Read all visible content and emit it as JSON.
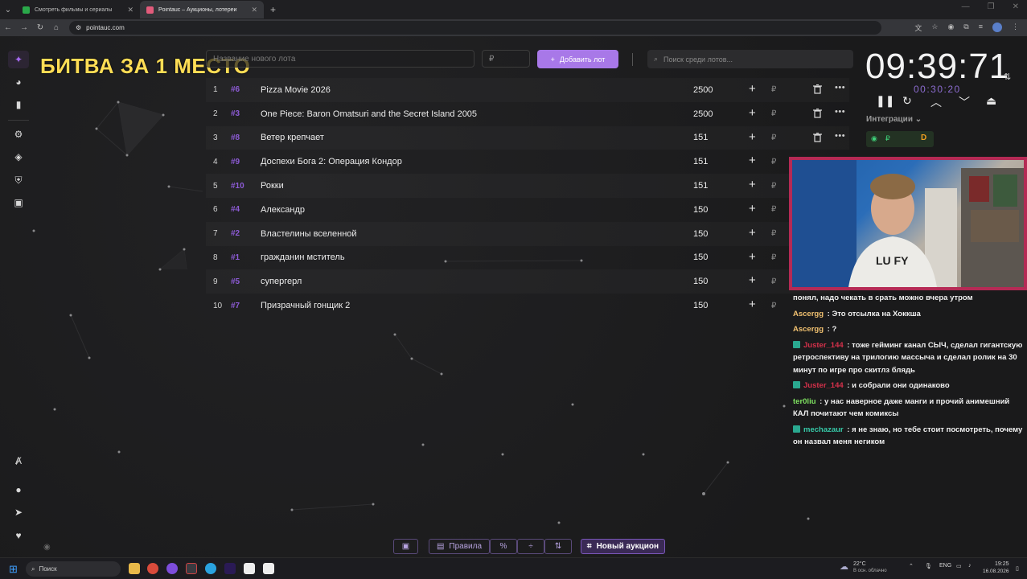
{
  "browser": {
    "tabs": [
      {
        "title": "Смотреть фильмы и сериалы",
        "active": false,
        "favicon_color": "#2aa84a"
      },
      {
        "title": "Pointauc – Аукционы, лотереи",
        "active": true,
        "favicon_color": "#e25b7b"
      }
    ],
    "url": "pointauc.com"
  },
  "overlay_title": "БИТВА ЗА 1 МЕСТО",
  "toolbar": {
    "lot_name_placeholder": "Название нового лота",
    "price_placeholder": "₽",
    "add_button": "Добавить лот",
    "search_placeholder": "Поиск среди лотов..."
  },
  "lots": [
    {
      "rank": "1",
      "id": "#6",
      "name": "Pizza Movie 2026",
      "amount": "2500"
    },
    {
      "rank": "2",
      "id": "#3",
      "name": "One Piece: Baron Omatsuri and the Secret Island 2005",
      "amount": "2500"
    },
    {
      "rank": "3",
      "id": "#8",
      "name": "Ветер крепчает",
      "amount": "151"
    },
    {
      "rank": "4",
      "id": "#9",
      "name": "Доспехи Бога 2: Операция Кондор",
      "amount": "151"
    },
    {
      "rank": "5",
      "id": "#10",
      "name": "Рокки",
      "amount": "151"
    },
    {
      "rank": "6",
      "id": "#4",
      "name": "Александр",
      "amount": "150"
    },
    {
      "rank": "7",
      "id": "#2",
      "name": "Властелины вселенной",
      "amount": "150"
    },
    {
      "rank": "8",
      "id": "#1",
      "name": "гражданин мститель",
      "amount": "150"
    },
    {
      "rank": "9",
      "id": "#5",
      "name": "супергерл",
      "amount": "150"
    },
    {
      "rank": "10",
      "id": "#7",
      "name": "Призрачный гонщик 2",
      "amount": "150"
    }
  ],
  "currency": "₽",
  "timer": {
    "main": "09:39:71",
    "sub": "00:30:20"
  },
  "integrations_label": "Интеграции",
  "chat": [
    {
      "user": "",
      "user_color": "#f0f0f0",
      "badge": false,
      "text": "понял, надо чекать в срать можно вчера утром"
    },
    {
      "user": "Ascergg",
      "user_color": "#f0c070",
      "badge": false,
      "text": "Это отсылка на Хоккша"
    },
    {
      "user": "Ascergg",
      "user_color": "#f0c070",
      "badge": false,
      "text": "?"
    },
    {
      "user": "Juster_144",
      "user_color": "#d4304a",
      "badge": true,
      "text": "тоже гейминг канал СЫЧ, сделал гигантскую ретроспективу на трилогию массыча и сделал ролик на 30 минут по игре про скитлз блядь"
    },
    {
      "user": "Juster_144",
      "user_color": "#d4304a",
      "badge": true,
      "text": "и собрали они одинаково"
    },
    {
      "user": "ter0liu",
      "user_color": "#7ee060",
      "badge": false,
      "text": "у нас наверное даже манги и прочий анимешний КАЛ почитают чем комиксы"
    },
    {
      "user": "mechazaur",
      "user_color": "#36c9a8",
      "badge": true,
      "text": "я не знаю, но тебе стоит посмотреть, почему он назвал меня негиком"
    }
  ],
  "bottom_toolbar": {
    "rules": "Правила",
    "new_auction": "Новый аукцион"
  },
  "taskbar": {
    "search": "Поиск",
    "weather_temp": "22°C",
    "weather_desc": "В осн. облачно",
    "lang": "ENG",
    "time": "19:25",
    "date": "16.08.2026"
  }
}
